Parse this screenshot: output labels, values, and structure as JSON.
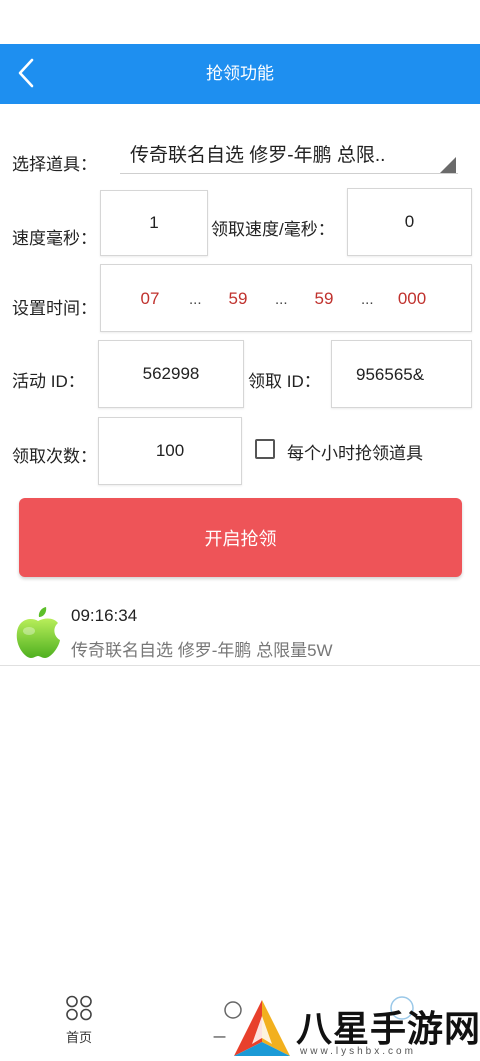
{
  "header": {
    "title": "抢领功能",
    "back_icon": "chevron-left-icon",
    "background": "#1e8ff0"
  },
  "form": {
    "item_label": "选择道具：",
    "item_value": "传奇联名自选 修罗-年鹏 总限..",
    "speed_label": "速度毫秒：",
    "speed_value": "1",
    "claim_speed_label": "领取速度/毫秒：",
    "claim_speed_value": "0",
    "time_label": "设置时间：",
    "time_parts": [
      "07",
      "59",
      "59",
      "000"
    ],
    "time_separator": "...",
    "activity_id_label": "活动 ID：",
    "activity_id_value": "562998",
    "claim_id_label": "领取 ID：",
    "claim_id_value": "956565&",
    "claim_count_label": "领取次数：",
    "claim_count_value": "100",
    "hourly_checkbox_label": "每个小时抢领道具",
    "hourly_checked": false
  },
  "start_button": {
    "label": "开启抢领",
    "color": "#ee5458"
  },
  "log": {
    "icon": "apple-icon",
    "time": "09:16:34",
    "message": "传奇联名自选 修罗-年鹏 总限量5W"
  },
  "bottom_nav": {
    "home_label": "首页",
    "home_icon": "four-circles-icon",
    "second_label": "一"
  },
  "watermark": {
    "text": "八星手游网",
    "url": "www.lyshbx.com"
  }
}
